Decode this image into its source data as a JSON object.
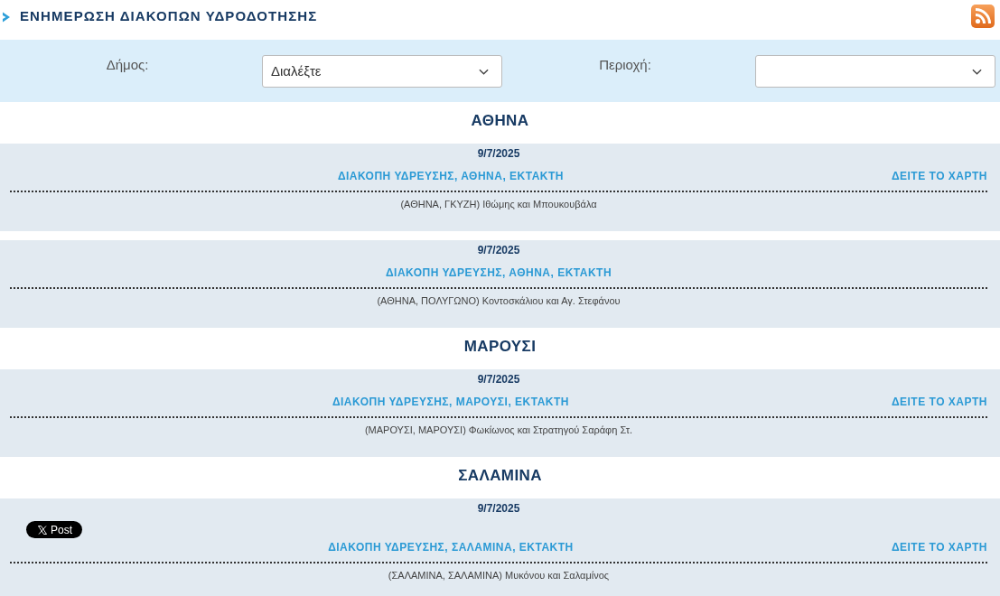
{
  "header": {
    "title": "ΕΝΗΜΕΡΩΣΗ ΔΙΑΚΟΠΩΝ ΥΔΡΟΔΟΤΗΣΗΣ"
  },
  "filters": [
    {
      "label": "Δήμος:",
      "value": "Διαλέξτε"
    },
    {
      "label": "Περιοχή:"
    }
  ],
  "groups": [
    {
      "name": "ΑΘΗΝΑ",
      "notices": [
        {
          "date": "9/7/2025",
          "title": "ΔΙΑΚΟΠΗ ΥΔΡΕΥΣΗΣ, ΑΘΗΝΑ, ΕΚΤΑΚΤΗ",
          "map_link": "ΔΕΙΤΕ ΤΟ ΧΑΡΤΗ",
          "details": "(ΑΘΗΝΑ, ΓΚΥΖΗ) Ιθώμης και Μπουκουβάλα"
        },
        {
          "date": "9/7/2025",
          "title": "ΔΙΑΚΟΠΗ ΥΔΡΕΥΣΗΣ, ΑΘΗΝΑ, ΕΚΤΑΚΤΗ",
          "details": "(ΑΘΗΝΑ, ΠΟΛΥΓΩΝΟ) Κοντοσκάλιου και Αγ. Στεφάνου"
        }
      ]
    },
    {
      "name": "ΜΑΡΟΥΣΙ",
      "notices": [
        {
          "date": "9/7/2025",
          "title": "ΔΙΑΚΟΠΗ ΥΔΡΕΥΣΗΣ, ΜΑΡΟΥΣΙ, ΕΚΤΑΚΤΗ",
          "map_link": "ΔΕΙΤΕ ΤΟ ΧΑΡΤΗ",
          "details": "(ΜΑΡΟΥΣΙ, ΜΑΡΟΥΣΙ) Φωκίωνος και Στρατηγού Σαράφη Στ."
        }
      ]
    },
    {
      "name": "ΣΑΛΑΜΙΝΑ",
      "notices": [
        {
          "date": "9/7/2025",
          "share_button": "Post",
          "title": "ΔΙΑΚΟΠΗ ΥΔΡΕΥΣΗΣ, ΣΑΛΑΜΙΝΑ, ΕΚΤΑΚΤΗ",
          "map_link": "ΔΕΙΤΕ ΤΟ ΧΑΡΤΗ",
          "details": "(ΣΑΛΑΜΙΝΑ, ΣΑΛΑΜΙΝΑ) Μυκόνου και Σαλαμίνος"
        }
      ]
    }
  ]
}
